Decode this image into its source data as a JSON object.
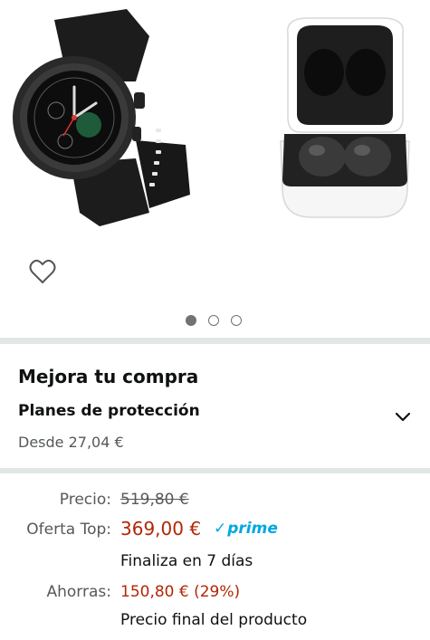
{
  "gallery": {
    "images": [
      "smartwatch-image",
      "earbuds-case-image"
    ],
    "dots": [
      {
        "active": true
      },
      {
        "active": false
      },
      {
        "active": false
      }
    ]
  },
  "upgrade": {
    "title": "Mejora tu compra",
    "plans_title": "Planes de protección",
    "plans_from": "Desde 27,04 €"
  },
  "pricing": {
    "list_label": "Precio:",
    "list_price": "519,80 €",
    "deal_label": "Oferta Top:",
    "deal_price": "369,00 €",
    "prime_text": "prime",
    "deal_ends": "Finaliza en 7 días",
    "savings_label": "Ahorras:",
    "savings_value": "150,80 € (29%)",
    "final_price_note": "Precio final del producto"
  },
  "colors": {
    "deal_red": "#b12704",
    "prime_blue": "#00a8e1",
    "divider": "#e3e6e6",
    "muted": "#565959"
  }
}
